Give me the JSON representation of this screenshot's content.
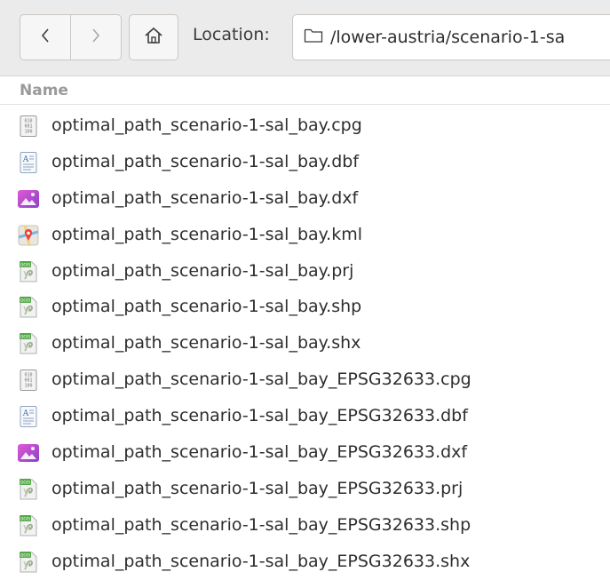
{
  "toolbar": {
    "back_icon": "chevron-left-icon",
    "forward_icon": "chevron-right-icon",
    "home_icon": "home-icon",
    "location_label": "Location:",
    "location_value": "/lower-austria/scenario-1-sa"
  },
  "list": {
    "column_header": "Name",
    "files": [
      {
        "name": "optimal_path_scenario-1-sal_bay.cpg",
        "icon": "binary-file-icon"
      },
      {
        "name": "optimal_path_scenario-1-sal_bay.dbf",
        "icon": "text-document-icon"
      },
      {
        "name": "optimal_path_scenario-1-sal_bay.dxf",
        "icon": "image-file-icon"
      },
      {
        "name": "optimal_path_scenario-1-sal_bay.kml",
        "icon": "map-file-icon"
      },
      {
        "name": "optimal_path_scenario-1-sal_bay.prj",
        "icon": "qgis-file-icon"
      },
      {
        "name": "optimal_path_scenario-1-sal_bay.shp",
        "icon": "qgis-file-icon"
      },
      {
        "name": "optimal_path_scenario-1-sal_bay.shx",
        "icon": "qgis-file-icon"
      },
      {
        "name": "optimal_path_scenario-1-sal_bay_EPSG32633.cpg",
        "icon": "binary-file-icon"
      },
      {
        "name": "optimal_path_scenario-1-sal_bay_EPSG32633.dbf",
        "icon": "text-document-icon"
      },
      {
        "name": "optimal_path_scenario-1-sal_bay_EPSG32633.dxf",
        "icon": "image-file-icon"
      },
      {
        "name": "optimal_path_scenario-1-sal_bay_EPSG32633.prj",
        "icon": "qgis-file-icon"
      },
      {
        "name": "optimal_path_scenario-1-sal_bay_EPSG32633.shp",
        "icon": "qgis-file-icon"
      },
      {
        "name": "optimal_path_scenario-1-sal_bay_EPSG32633.shx",
        "icon": "qgis-file-icon"
      }
    ]
  }
}
